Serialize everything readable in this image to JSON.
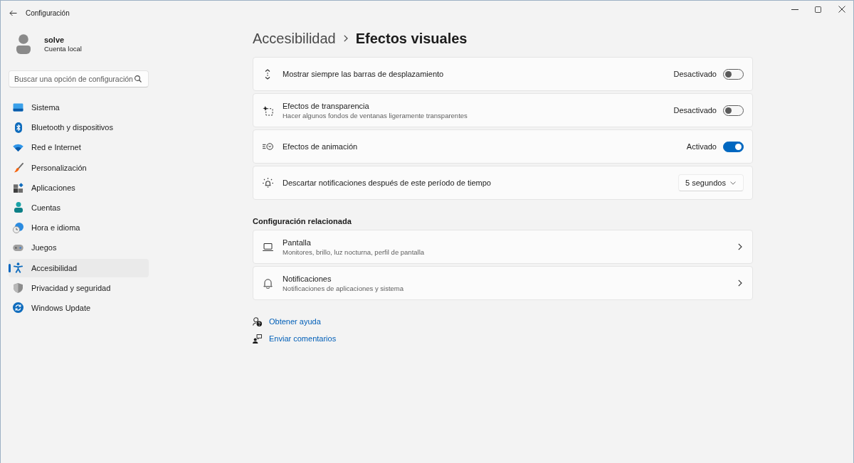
{
  "window": {
    "title": "Configuración"
  },
  "account": {
    "name": "solve",
    "type": "Cuenta local"
  },
  "search": {
    "placeholder": "Buscar una opción de configuración"
  },
  "sidebar": {
    "items": [
      {
        "label": "Sistema",
        "selected": false
      },
      {
        "label": "Bluetooth y dispositivos",
        "selected": false
      },
      {
        "label": "Red e Internet",
        "selected": false
      },
      {
        "label": "Personalización",
        "selected": false
      },
      {
        "label": "Aplicaciones",
        "selected": false
      },
      {
        "label": "Cuentas",
        "selected": false
      },
      {
        "label": "Hora e idioma",
        "selected": false
      },
      {
        "label": "Juegos",
        "selected": false
      },
      {
        "label": "Accesibilidad",
        "selected": true
      },
      {
        "label": "Privacidad y seguridad",
        "selected": false
      },
      {
        "label": "Windows Update",
        "selected": false
      }
    ]
  },
  "breadcrumb": {
    "parent": "Accesibilidad",
    "current": "Efectos visuales"
  },
  "settings": [
    {
      "kind": "toggle",
      "label": "Mostrar siempre las barras de desplazamiento",
      "state_label": "Desactivado",
      "on": false
    },
    {
      "kind": "toggle",
      "label": "Efectos de transparencia",
      "description": "Hacer algunos fondos de ventanas ligeramente transparentes",
      "state_label": "Desactivado",
      "on": false
    },
    {
      "kind": "toggle",
      "label": "Efectos de animación",
      "state_label": "Activado",
      "on": true
    },
    {
      "kind": "dropdown",
      "label": "Descartar notificaciones después de este período de tiempo",
      "value": "5 segundos"
    }
  ],
  "related": {
    "title": "Configuración relacionada",
    "items": [
      {
        "title": "Pantalla",
        "description": "Monitores, brillo, luz nocturna, perfil de pantalla"
      },
      {
        "title": "Notificaciones",
        "description": "Notificaciones de aplicaciones y sistema"
      }
    ]
  },
  "links": [
    "Obtener ayuda",
    "Enviar comentarios"
  ]
}
